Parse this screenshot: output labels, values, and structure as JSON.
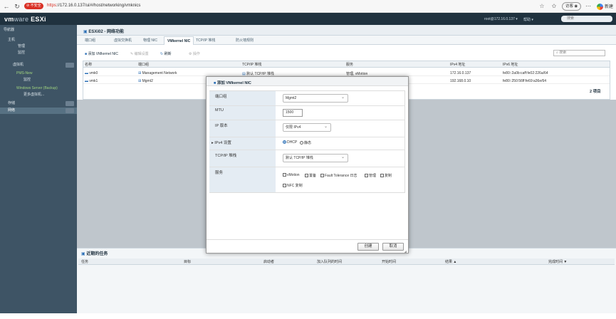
{
  "browser": {
    "security_label": "不安全",
    "url_proto": "https",
    "url_rest": "://172.16.0.137/ui/#/host/networking/vmknics",
    "guest_label": "访客",
    "new_label": "新建"
  },
  "app": {
    "logo_vm": "vm",
    "logo_rest": "ware",
    "logo_product": " ESXi",
    "user": "root@172.16.0.137 ▾",
    "help": "帮助 ▾",
    "search_placeholder": "搜索"
  },
  "sidebar": {
    "items": [
      {
        "label": "导航器"
      },
      {
        "label": "主机"
      },
      {
        "label": "管理"
      },
      {
        "label": "监控"
      },
      {
        "label": "虚拟机"
      },
      {
        "label": "PMS-New"
      },
      {
        "label": "监控"
      },
      {
        "label": "Windows Server (Backup)"
      },
      {
        "label": "更多虚拟机..."
      },
      {
        "label": "存储"
      },
      {
        "label": "网络"
      }
    ]
  },
  "main": {
    "breadcrumb": "ESXi02 - 网络功能",
    "tabs": [
      {
        "label": "端口组"
      },
      {
        "label": "虚拟交换机"
      },
      {
        "label": "物理 NIC"
      },
      {
        "label": "VMkernel NIC"
      },
      {
        "label": "TCP/IP 堆栈"
      },
      {
        "label": "防火墙规则"
      }
    ],
    "toolbar": {
      "add": "添加 VMkernel NIC",
      "edit": "编辑设置",
      "refresh": "刷新",
      "actions": "操作"
    },
    "search_placeholder": "搜索",
    "columns": [
      "名称",
      "端口组",
      "TCP/IP 堆栈",
      "服务",
      "IPv4 地址",
      "IPv6 地址"
    ],
    "rows": [
      {
        "name": "vmk0",
        "portgroup": "Management Network",
        "stack": "默认 TCP/IP 堆栈",
        "services": "管理, vMotion",
        "ipv4": "172.16.0.137",
        "ipv6": "fe80::2a0b:caff:fe02:226a/64"
      },
      {
        "name": "vmk1",
        "portgroup": "Mgmt2",
        "stack": "默认 TCP/IP 堆栈",
        "services": "",
        "ipv4": "192.168.0.10",
        "ipv6": "fe80::250:56ff:fe69:a36e/64"
      }
    ],
    "item_count": "2 项目"
  },
  "recent_tasks": {
    "title": "近期的任务",
    "columns": [
      "任务",
      "目标",
      "启动者",
      "加入队列的时间",
      "开始时间",
      "结果 ▲",
      "完成时间 ▼"
    ]
  },
  "dialog": {
    "title": "添加 VMkernel NIC",
    "fields": {
      "portgroup_label": "端口组",
      "portgroup_value": "Mgmt2",
      "mtu_label": "MTU",
      "mtu_value": "1500",
      "ipver_label": "IP 版本",
      "ipver_value": "仅限 IPv4",
      "ipv4_label": "IPv4 设置",
      "dhcp_label": "DHCP",
      "static_label": "静态",
      "stack_label": "TCP/IP 堆栈",
      "stack_value": "默认 TCP/IP 堆栈",
      "services_label": "服务",
      "svc_vmotion": "vMotion",
      "svc_provisioning": "置备",
      "svc_ft": "Fault Tolerance 日志",
      "svc_mgmt": "管理",
      "svc_replication": "复制",
      "svc_nfc": "NFC 复制"
    },
    "create": "创建",
    "cancel": "取消"
  }
}
